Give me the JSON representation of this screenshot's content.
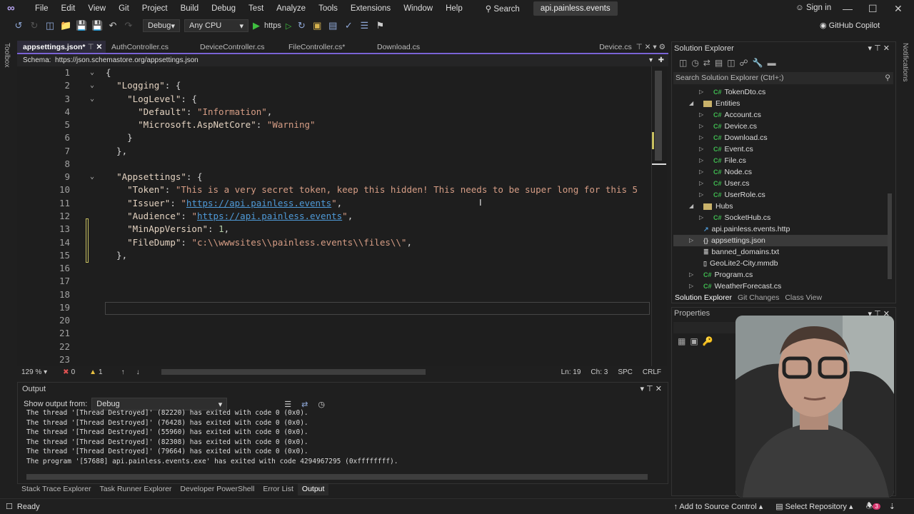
{
  "menubar": {
    "items": [
      "File",
      "Edit",
      "View",
      "Git",
      "Project",
      "Build",
      "Debug",
      "Test",
      "Analyze",
      "Tools",
      "Extensions",
      "Window",
      "Help"
    ],
    "search": "Search",
    "solution_title": "api.painless.events",
    "sign_in": "Sign in"
  },
  "toolbar": {
    "config": "Debug",
    "platform": "Any CPU",
    "run_profile": "https",
    "copilot": "GitHub Copilot"
  },
  "toolbox_label": "Toolbox",
  "notifications_label": "Notifications",
  "tabs": [
    "appsettings.json*",
    "AuthController.cs",
    "DeviceController.cs",
    "FileController.cs*",
    "Download.cs"
  ],
  "pinned_tab": "Device.cs",
  "schema": {
    "label": "Schema:",
    "url": "https://json.schemastore.org/appsettings.json"
  },
  "editor": {
    "lines": [
      [
        {
          "t": "{",
          "c": "p"
        }
      ],
      [
        {
          "t": "  "
        },
        {
          "t": "\"Logging\"",
          "c": "k"
        },
        {
          "t": ": {",
          "c": "p"
        }
      ],
      [
        {
          "t": "    "
        },
        {
          "t": "\"LogLevel\"",
          "c": "k"
        },
        {
          "t": ": {",
          "c": "p"
        }
      ],
      [
        {
          "t": "      "
        },
        {
          "t": "\"Default\"",
          "c": "k"
        },
        {
          "t": ": ",
          "c": "p"
        },
        {
          "t": "\"Information\"",
          "c": "s"
        },
        {
          "t": ",",
          "c": "p"
        }
      ],
      [
        {
          "t": "      "
        },
        {
          "t": "\"Microsoft.AspNetCore\"",
          "c": "k"
        },
        {
          "t": ": ",
          "c": "p"
        },
        {
          "t": "\"Warning\"",
          "c": "s"
        }
      ],
      [
        {
          "t": "    }",
          "c": "p"
        }
      ],
      [
        {
          "t": "  },",
          "c": "p"
        }
      ],
      [],
      [
        {
          "t": "  "
        },
        {
          "t": "\"Appsettings\"",
          "c": "k"
        },
        {
          "t": ": {",
          "c": "p"
        }
      ],
      [
        {
          "t": "    "
        },
        {
          "t": "\"Token\"",
          "c": "k"
        },
        {
          "t": ": ",
          "c": "p"
        },
        {
          "t": "\"This is a very secret token, keep this hidden! This needs to be super long for this 5",
          "c": "s"
        }
      ],
      [
        {
          "t": "    "
        },
        {
          "t": "\"Issuer\"",
          "c": "k"
        },
        {
          "t": ": ",
          "c": "p"
        },
        {
          "t": "\"",
          "c": "s"
        },
        {
          "t": "https://api.painless.events",
          "c": "u"
        },
        {
          "t": "\"",
          "c": "s"
        },
        {
          "t": ",",
          "c": "p"
        }
      ],
      [
        {
          "t": "    "
        },
        {
          "t": "\"Audience\"",
          "c": "k"
        },
        {
          "t": ": ",
          "c": "p"
        },
        {
          "t": "\"",
          "c": "s"
        },
        {
          "t": "https://api.painless.events",
          "c": "u"
        },
        {
          "t": "\"",
          "c": "s"
        },
        {
          "t": ",",
          "c": "p"
        }
      ],
      [
        {
          "t": "    "
        },
        {
          "t": "\"MinAppVersion\"",
          "c": "k"
        },
        {
          "t": ": ",
          "c": "p"
        },
        {
          "t": "1",
          "c": "n"
        },
        {
          "t": ",",
          "c": "p"
        }
      ],
      [
        {
          "t": "    "
        },
        {
          "t": "\"FileDump\"",
          "c": "k"
        },
        {
          "t": ": ",
          "c": "p"
        },
        {
          "t": "\"c:\\\\wwwsites\\\\painless.events\\\\files\\\\\"",
          "c": "s"
        },
        {
          "t": ",",
          "c": "p"
        }
      ],
      [
        {
          "t": "  },",
          "c": "p"
        }
      ],
      [],
      [],
      [],
      [],
      [],
      [],
      [],
      []
    ],
    "folds": [
      1,
      2,
      3,
      9
    ]
  },
  "editor_status": {
    "zoom": "129 %",
    "errors": "0",
    "warnings": "1",
    "line": "Ln: 19",
    "char": "Ch: 3",
    "spacing": "SPC",
    "eol": "CRLF"
  },
  "output": {
    "title": "Output",
    "show_from_label": "Show output from:",
    "source": "Debug",
    "lines": [
      "The thread '[Thread Destroyed]' (82220) has exited with code 0 (0x0).",
      "The thread '[Thread Destroyed]' (76428) has exited with code 0 (0x0).",
      "The thread '[Thread Destroyed]' (55960) has exited with code 0 (0x0).",
      "The thread '[Thread Destroyed]' (82308) has exited with code 0 (0x0).",
      "The thread '[Thread Destroyed]' (79664) has exited with code 0 (0x0).",
      "The program '[57688] api.painless.events.exe' has exited with code 4294967295 (0xffffffff)."
    ]
  },
  "bottom_tabs": [
    "Stack Trace Explorer",
    "Task Runner Explorer",
    "Developer PowerShell",
    "Error List",
    "Output"
  ],
  "status": {
    "ready": "Ready",
    "source_control": "Add to Source Control",
    "repository": "Select Repository",
    "notification_count": "3"
  },
  "solution_explorer": {
    "title": "Solution Explorer",
    "search_placeholder": "Search Solution Explorer (Ctrl+;)",
    "items": [
      {
        "label": "TokenDto.cs",
        "type": "cs",
        "depth": 3,
        "arrow": "closed"
      },
      {
        "label": "Entities",
        "type": "folder",
        "depth": 2,
        "arrow": "open"
      },
      {
        "label": "Account.cs",
        "type": "cs",
        "depth": 3,
        "arrow": "closed"
      },
      {
        "label": "Device.cs",
        "type": "cs",
        "depth": 3,
        "arrow": "closed"
      },
      {
        "label": "Download.cs",
        "type": "cs",
        "depth": 3,
        "arrow": "closed"
      },
      {
        "label": "Event.cs",
        "type": "cs",
        "depth": 3,
        "arrow": "closed"
      },
      {
        "label": "File.cs",
        "type": "cs",
        "depth": 3,
        "arrow": "closed"
      },
      {
        "label": "Node.cs",
        "type": "cs",
        "depth": 3,
        "arrow": "closed"
      },
      {
        "label": "User.cs",
        "type": "cs",
        "depth": 3,
        "arrow": "closed"
      },
      {
        "label": "UserRole.cs",
        "type": "cs",
        "depth": 3,
        "arrow": "closed"
      },
      {
        "label": "Hubs",
        "type": "folder",
        "depth": 2,
        "arrow": "open"
      },
      {
        "label": "SocketHub.cs",
        "type": "cs",
        "depth": 3,
        "arrow": "closed"
      },
      {
        "label": "api.painless.events.http",
        "type": "http",
        "depth": 2,
        "arrow": "none"
      },
      {
        "label": "appsettings.json",
        "type": "json",
        "depth": 2,
        "arrow": "closed",
        "selected": true
      },
      {
        "label": "banned_domains.txt",
        "type": "txt",
        "depth": 2,
        "arrow": "none"
      },
      {
        "label": "GeoLite2-City.mmdb",
        "type": "file",
        "depth": 2,
        "arrow": "none"
      },
      {
        "label": "Program.cs",
        "type": "cs",
        "depth": 2,
        "arrow": "closed"
      },
      {
        "label": "WeatherForecast.cs",
        "type": "cs",
        "depth": 2,
        "arrow": "closed"
      }
    ],
    "tabs": [
      "Solution Explorer",
      "Git Changes",
      "Class View"
    ]
  },
  "properties": {
    "title": "Properties"
  }
}
